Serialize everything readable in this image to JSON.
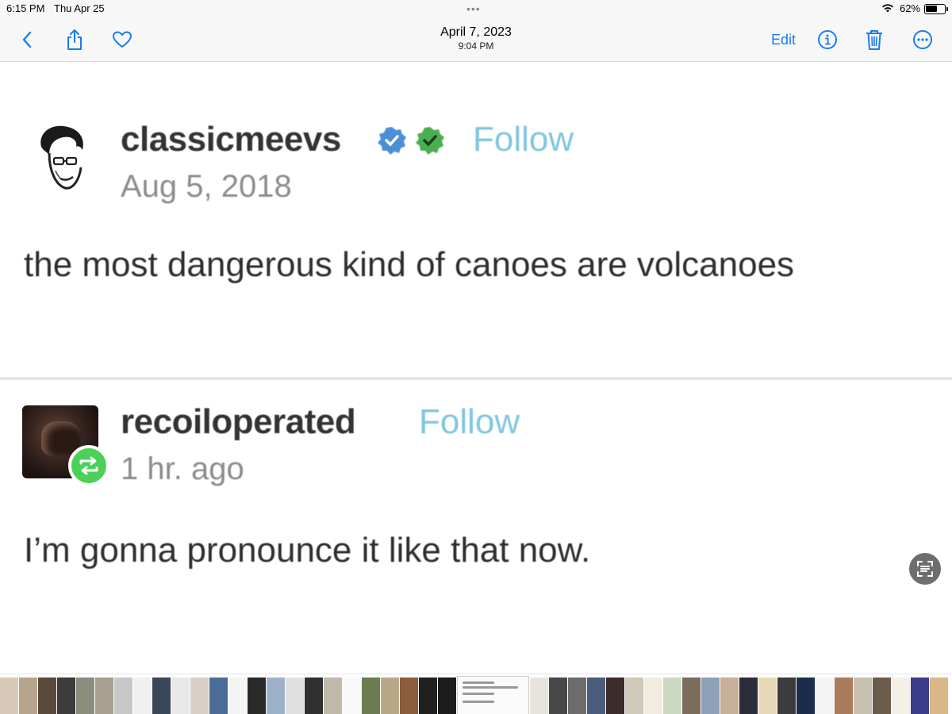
{
  "status_bar": {
    "time": "6:15 PM",
    "date": "Thu Apr 25",
    "multitask_dots": "•••",
    "battery": "62%",
    "battery_level": 0.62
  },
  "nav": {
    "title": "April 7, 2023",
    "subtitle": "9:04 PM",
    "edit_label": "Edit",
    "accent_color": "#1a7cf0"
  },
  "posts": [
    {
      "username": "classicmeevs",
      "follow_label": "Follow",
      "date": "Aug 5, 2018",
      "text": "the most dangerous kind of canoes are volcanoes",
      "badges": [
        "blue-check-badge",
        "green-check-badge"
      ]
    },
    {
      "username": "recoiloperated",
      "follow_label": "Follow",
      "date": "1 hr. ago",
      "text": "I’m gonna pronounce it like that now.",
      "badges": [
        "reblog-badge"
      ]
    }
  ],
  "colors": {
    "follow": "#7fc6df",
    "reblog_green": "#4cd05a",
    "verified_blue": "#4a90d9",
    "verified_green": "#4caf50"
  },
  "thumbnail_strip": {
    "current_index": 24,
    "thumbs": [
      "#d8c9b8",
      "#b8a48c",
      "#5a4a3c",
      "#3c3c3c",
      "#8c8c7c",
      "#a8a090",
      "#c8c8c8",
      "#f0f0f0",
      "#384858",
      "#e8e8e8",
      "#d8d0c8",
      "#4c6c98",
      "#f4f4f4",
      "#2a2a2a",
      "#9cb0c8",
      "#e0e0e0",
      "#303030",
      "#c0b8a8",
      "#f8f8f8",
      "#6c7c50",
      "#b8a888",
      "#8c5c3c",
      "#202020",
      "#1c1c1c",
      "#ffffff",
      "#e8e4dc",
      "#484848",
      "#6c6c6c",
      "#4c5c7c",
      "#3c2c2c",
      "#d0c8b8",
      "#f0ece0",
      "#ccd8c0",
      "#7c6c5c",
      "#8ca0b8",
      "#c8b098",
      "#2c2c3c",
      "#e8d8b8",
      "#3c3c3c",
      "#1c2c4c",
      "#f4f4f4",
      "#a87c5c",
      "#c8c0b0",
      "#6c5c4c",
      "#f4f0e8",
      "#3c3c8c",
      "#d8b888"
    ]
  }
}
